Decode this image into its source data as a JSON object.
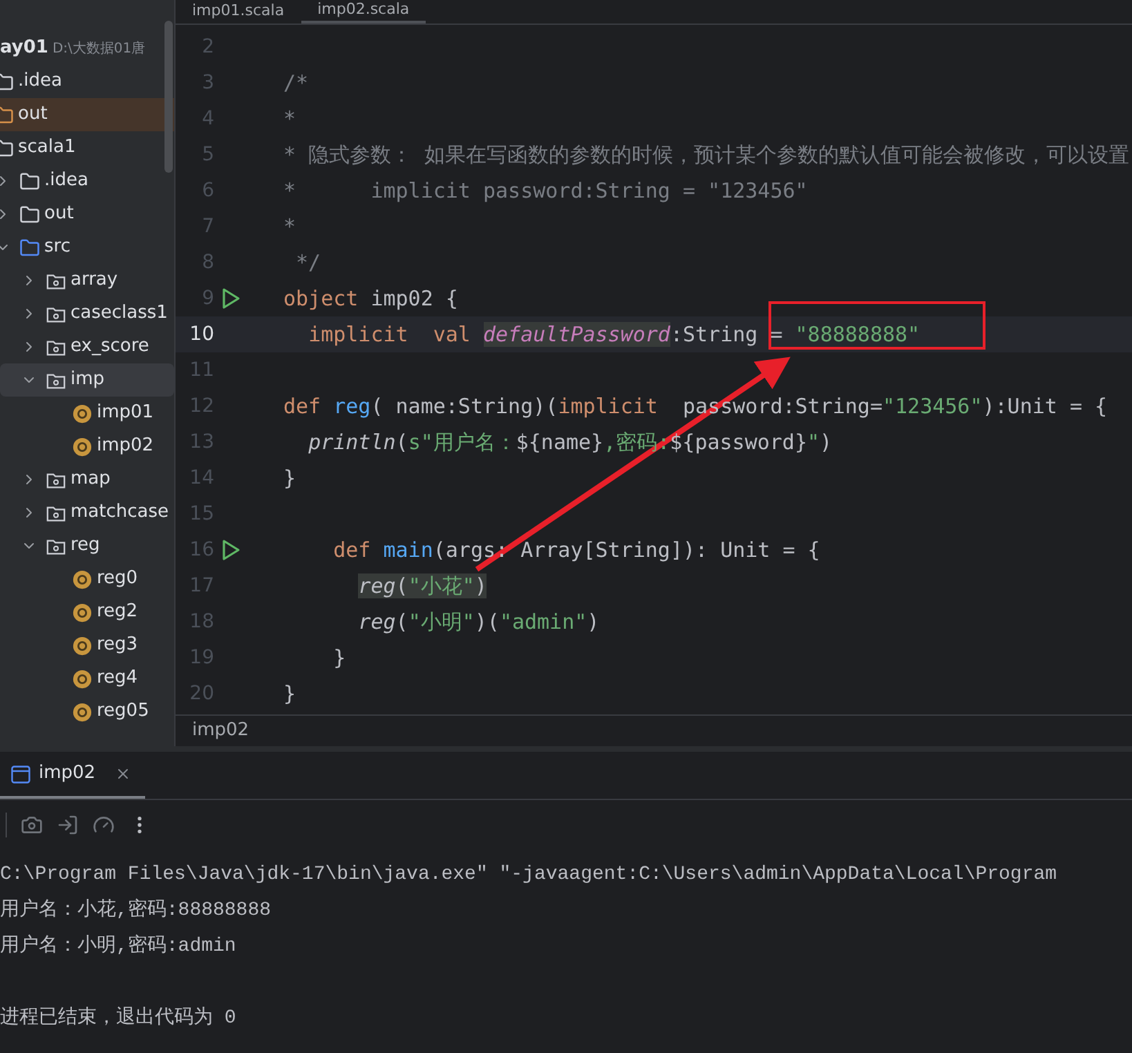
{
  "project_tree": {
    "name": "ay01",
    "path": "D:\\大数据01唐",
    "children": [
      {
        "name": ".idea",
        "kind": "folder",
        "selected": false
      },
      {
        "name": "out",
        "kind": "excluded",
        "selected": false
      },
      {
        "name": "scala1",
        "kind": "folder",
        "selected": false,
        "children": [
          {
            "name": ".idea",
            "kind": "folder",
            "expanded": false,
            "selected": false
          },
          {
            "name": "out",
            "kind": "folder",
            "expanded": false,
            "selected": false
          },
          {
            "name": "src",
            "kind": "source",
            "expanded": true,
            "selected": false,
            "children": [
              {
                "name": "array",
                "kind": "package",
                "expanded": false,
                "selected": false
              },
              {
                "name": "caseclass1",
                "kind": "package",
                "expanded": false,
                "selected": false
              },
              {
                "name": "ex_score",
                "kind": "package",
                "expanded": false,
                "selected": false
              },
              {
                "name": "imp",
                "kind": "package",
                "expanded": true,
                "selected": true,
                "children": [
                  {
                    "name": "imp01",
                    "kind": "object",
                    "selected": false
                  },
                  {
                    "name": "imp02",
                    "kind": "object",
                    "selected": false
                  }
                ]
              },
              {
                "name": "map",
                "kind": "package",
                "expanded": false,
                "selected": false
              },
              {
                "name": "matchcase",
                "kind": "package",
                "expanded": false,
                "selected": false
              },
              {
                "name": "reg",
                "kind": "package",
                "expanded": true,
                "selected": false,
                "children": [
                  {
                    "name": "reg0",
                    "kind": "object",
                    "selected": false
                  },
                  {
                    "name": "reg2",
                    "kind": "object",
                    "selected": false
                  },
                  {
                    "name": "reg3",
                    "kind": "object",
                    "selected": false
                  },
                  {
                    "name": "reg4",
                    "kind": "object",
                    "selected": false
                  },
                  {
                    "name": "reg05",
                    "kind": "object",
                    "selected": false
                  }
                ]
              }
            ]
          }
        ]
      }
    ]
  },
  "editor_tabs": [
    {
      "label": "imp01.scala",
      "selected": false
    },
    {
      "label": "imp02.scala",
      "selected": true
    }
  ],
  "code_lines": [
    {
      "number": "2",
      "current": false,
      "runnable": false
    },
    {
      "number": "3",
      "current": false,
      "runnable": false,
      "tokens": [
        {
          "text": "/*",
          "kind": "comment"
        }
      ]
    },
    {
      "number": "4",
      "current": false,
      "runnable": false,
      "tokens": [
        {
          "text": "*",
          "kind": "comment"
        }
      ]
    },
    {
      "number": "5",
      "current": false,
      "runnable": false,
      "tokens": [
        {
          "text": "* 隐式参数： 如果在写函数的参数的时候，预计某个参数的默认值可能会被修改，可以设置",
          "kind": "comment"
        }
      ]
    },
    {
      "number": "6",
      "current": false,
      "runnable": false,
      "tokens": [
        {
          "text": "*      implicit password:String = \"123456\"",
          "kind": "comment"
        }
      ]
    },
    {
      "number": "7",
      "current": false,
      "runnable": false,
      "tokens": [
        {
          "text": "*",
          "kind": "comment"
        }
      ]
    },
    {
      "number": "8",
      "current": false,
      "runnable": false,
      "tokens": [
        {
          "text": " */",
          "kind": "comment"
        }
      ]
    },
    {
      "number": "9",
      "current": false,
      "runnable": true,
      "tokens": [
        {
          "text": "object",
          "kind": "keyword"
        },
        {
          "text": " imp02 {",
          "kind": "plain"
        }
      ]
    },
    {
      "number": "10",
      "current": true,
      "runnable": false,
      "tokens": [
        {
          "text": "  implicit  val ",
          "kind": "keyword",
          "marked": false
        },
        {
          "text": "defaultPassword",
          "kind": "field",
          "marked": true
        },
        {
          "text": ":String = ",
          "kind": "plain",
          "marked": false
        },
        {
          "text": "\"88888888\"",
          "kind": "string",
          "marked": false
        }
      ]
    },
    {
      "number": "11",
      "current": false,
      "runnable": false
    },
    {
      "number": "12",
      "current": false,
      "runnable": false,
      "tokens": [
        {
          "text": "def ",
          "kind": "keyword"
        },
        {
          "text": "reg",
          "kind": "function"
        },
        {
          "text": "( name:String)(",
          "kind": "plain"
        },
        {
          "text": "implicit",
          "kind": "keyword"
        },
        {
          "text": "  password:String=",
          "kind": "plain"
        },
        {
          "text": "\"123456\"",
          "kind": "string"
        },
        {
          "text": "):Unit = {",
          "kind": "plain"
        }
      ]
    },
    {
      "number": "13",
      "current": false,
      "runnable": false,
      "tokens": [
        {
          "text": "  println",
          "kind": "italic"
        },
        {
          "text": "(",
          "kind": "plain"
        },
        {
          "text": "s\"用户名：",
          "kind": "string"
        },
        {
          "text": "${name}",
          "kind": "plain"
        },
        {
          "text": ",密码:",
          "kind": "string"
        },
        {
          "text": "${password}",
          "kind": "plain"
        },
        {
          "text": "\"",
          "kind": "string"
        },
        {
          "text": ")",
          "kind": "plain"
        }
      ]
    },
    {
      "number": "14",
      "current": false,
      "runnable": false,
      "tokens": [
        {
          "text": "}",
          "kind": "plain"
        }
      ]
    },
    {
      "number": "15",
      "current": false,
      "runnable": false
    },
    {
      "number": "16",
      "current": false,
      "runnable": true,
      "tokens": [
        {
          "text": "    def ",
          "kind": "keyword"
        },
        {
          "text": "main",
          "kind": "function"
        },
        {
          "text": "(args: Array[String]): Unit = {",
          "kind": "plain"
        }
      ]
    },
    {
      "number": "17",
      "current": false,
      "runnable": false,
      "tokens": [
        {
          "text": "      reg",
          "kind": "italic",
          "marked": true
        },
        {
          "text": "(",
          "kind": "plain",
          "marked": true
        },
        {
          "text": "\"小花\"",
          "kind": "string",
          "marked": true
        },
        {
          "text": ")",
          "kind": "plain",
          "marked": true
        }
      ]
    },
    {
      "number": "18",
      "current": false,
      "runnable": false,
      "tokens": [
        {
          "text": "      reg",
          "kind": "italic"
        },
        {
          "text": "(",
          "kind": "plain"
        },
        {
          "text": "\"小明\"",
          "kind": "string"
        },
        {
          "text": ")(",
          "kind": "plain"
        },
        {
          "text": "\"admin\"",
          "kind": "string"
        },
        {
          "text": ")",
          "kind": "plain"
        }
      ]
    },
    {
      "number": "19",
      "current": false,
      "runnable": false,
      "tokens": [
        {
          "text": "    }",
          "kind": "plain"
        }
      ]
    },
    {
      "number": "20",
      "current": false,
      "runnable": false,
      "tokens": [
        {
          "text": "}",
          "kind": "plain"
        }
      ]
    }
  ],
  "breadcrumb": "imp02",
  "run_panel": {
    "tab": {
      "label": "imp02",
      "selected": true
    },
    "output": [
      {
        "text": "C:\\Program Files\\Java\\jdk-17\\bin\\java.exe\" \"-javaagent:C:\\Users\\admin\\AppData\\Local\\Program",
        "kind": "command"
      },
      {
        "text": "用户名：小花,密码:88888888",
        "kind": "output"
      },
      {
        "text": "用户名：小明,密码:admin",
        "kind": "output"
      },
      {
        "text": "进程已结束，退出代码为 0",
        "kind": "exit"
      }
    ]
  }
}
